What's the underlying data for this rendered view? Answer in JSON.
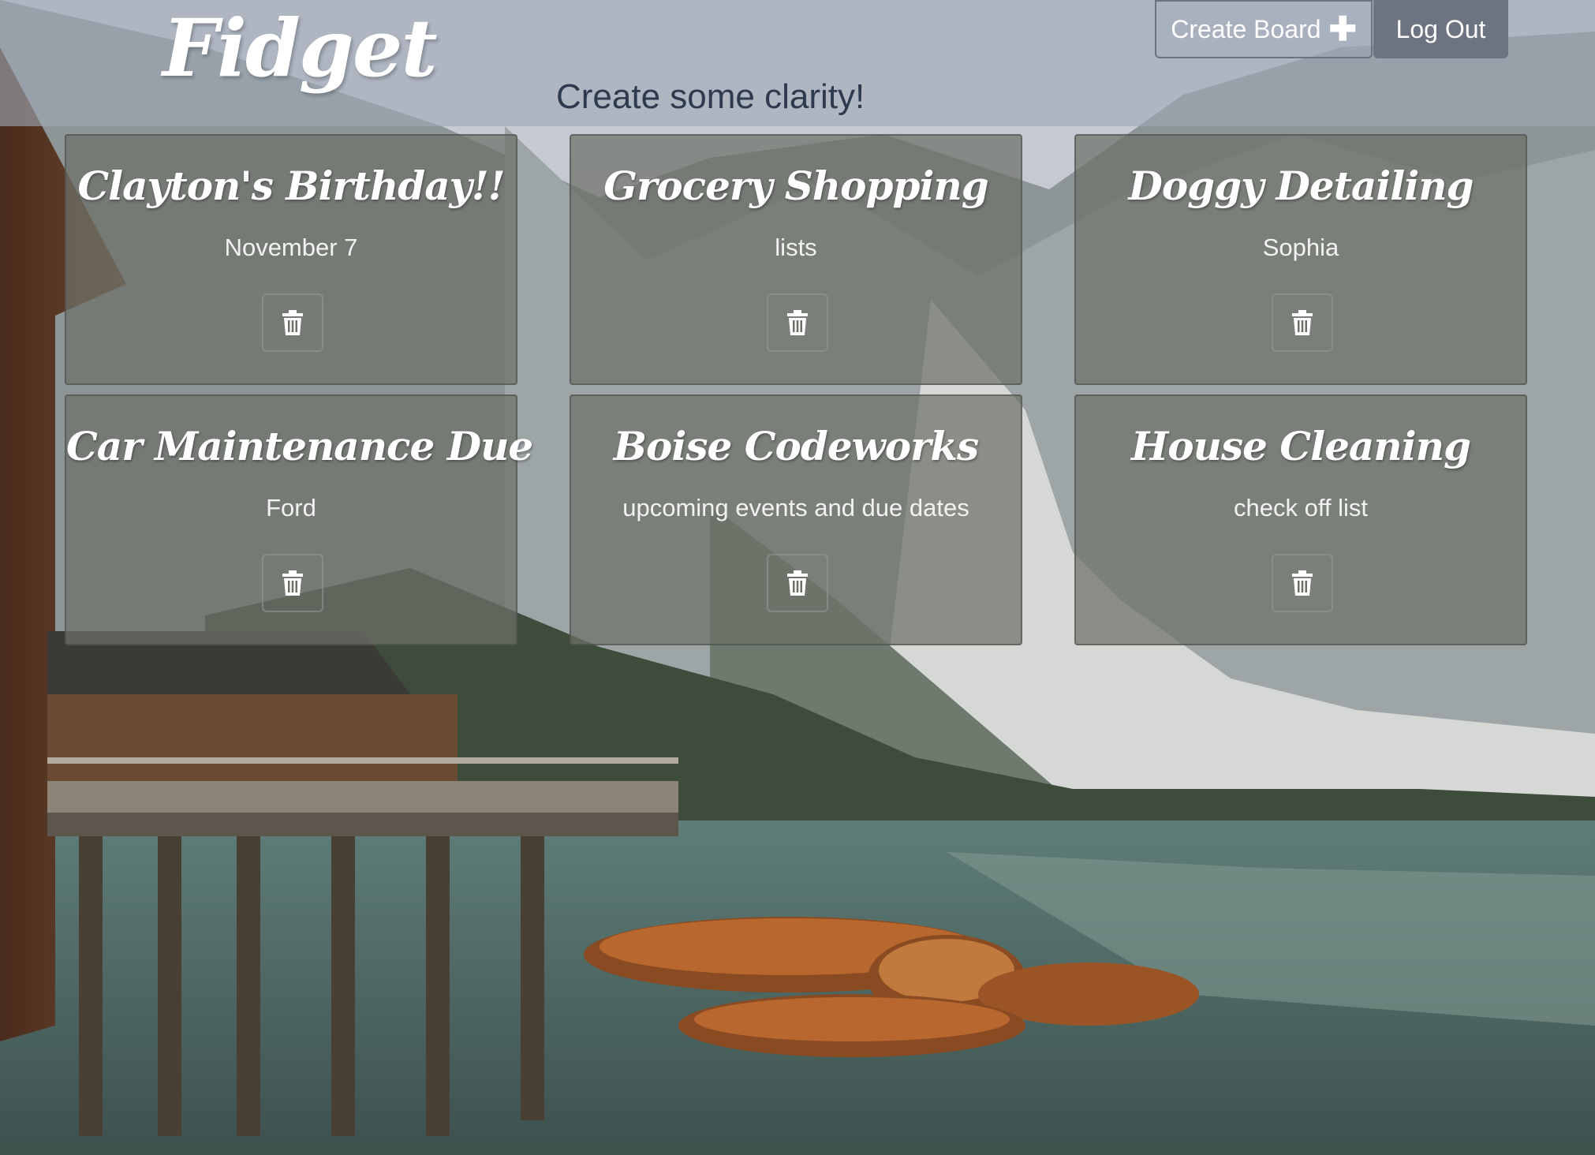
{
  "app": {
    "logo": "Fidget",
    "tagline": "Create some clarity!"
  },
  "header": {
    "create_board_label": "Create Board",
    "create_board_icon": "plus-icon",
    "logout_label": "Log Out"
  },
  "boards": [
    {
      "title": "Clayton's Birthday!!",
      "subtitle": "November 7",
      "delete_icon": "trash-icon"
    },
    {
      "title": "Grocery Shopping",
      "subtitle": "lists",
      "delete_icon": "trash-icon"
    },
    {
      "title": "Doggy Detailing",
      "subtitle": "Sophia",
      "delete_icon": "trash-icon"
    },
    {
      "title": "Car Maintenance Due",
      "subtitle": "Ford",
      "delete_icon": "trash-icon"
    },
    {
      "title": "Boise Codeworks",
      "subtitle": "upcoming events and due dates",
      "delete_icon": "trash-icon"
    },
    {
      "title": "House Cleaning",
      "subtitle": "check off list",
      "delete_icon": "trash-icon"
    }
  ],
  "colors": {
    "header_bg": "#a0a8b6",
    "tagline": "#2e3a4d",
    "logout_bg": "#6b7480",
    "card_bg": "#6e7068",
    "text": "#ffffff"
  }
}
